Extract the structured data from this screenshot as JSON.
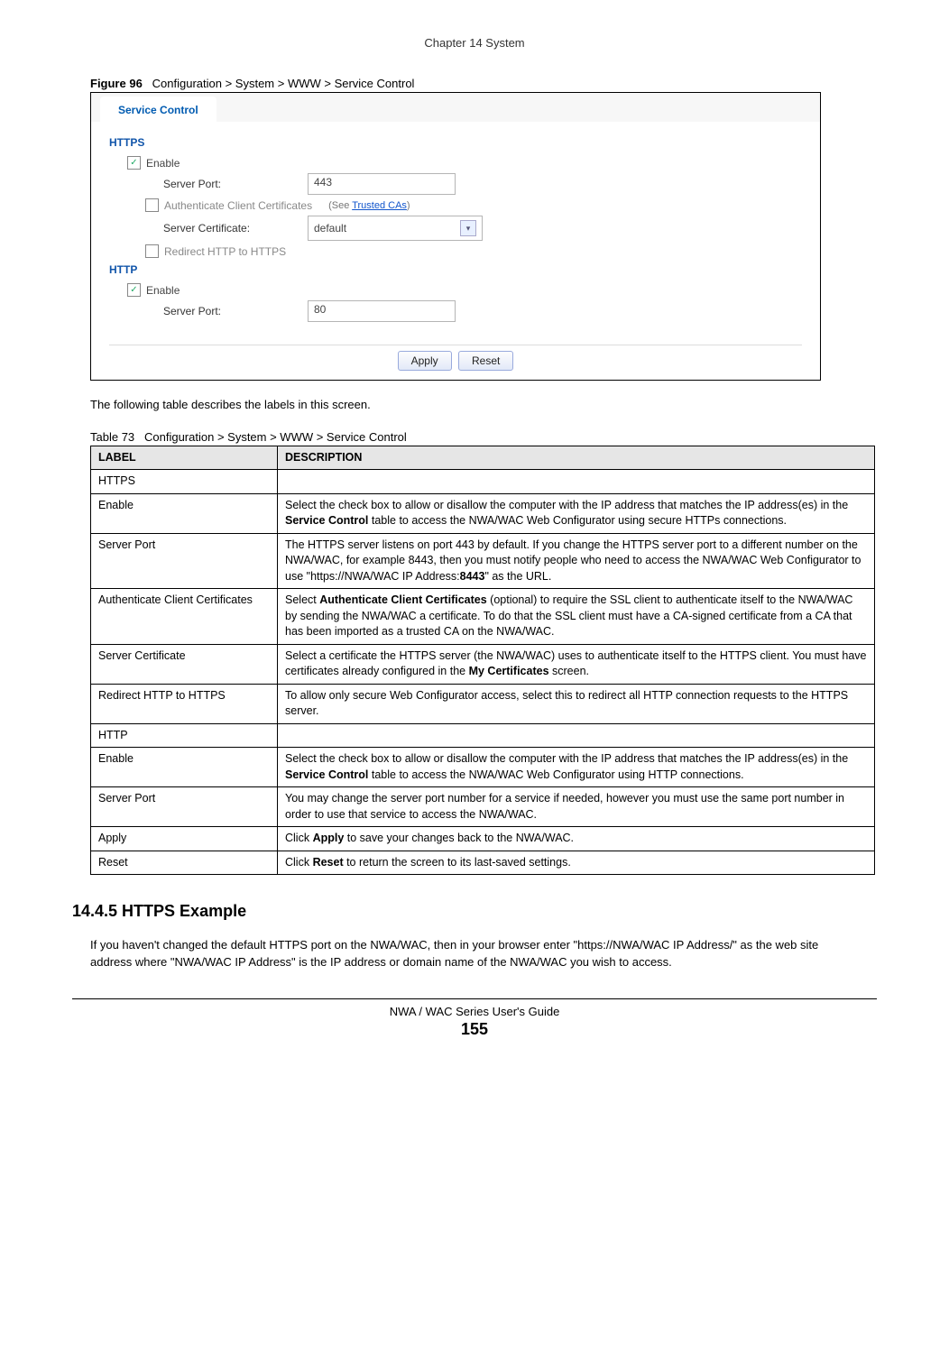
{
  "chapter_header": "Chapter 14 System",
  "figure": {
    "label": "Figure 96",
    "caption": "Configuration > System > WWW > Service Control"
  },
  "screenshot": {
    "tab": "Service Control",
    "https": {
      "title": "HTTPS",
      "enable_label": "Enable",
      "enable_checked": "✓",
      "server_port_label": "Server Port:",
      "server_port_value": "443",
      "auth_cert_label": "Authenticate Client Certificates",
      "see_prefix": "(See ",
      "see_link": "Trusted CAs",
      "see_suffix": ")",
      "server_cert_label": "Server Certificate:",
      "server_cert_value": "default",
      "redirect_label": "Redirect HTTP to HTTPS"
    },
    "http": {
      "title": "HTTP",
      "enable_label": "Enable",
      "enable_checked": "✓",
      "server_port_label": "Server Port:",
      "server_port_value": "80"
    },
    "buttons": {
      "apply": "Apply",
      "reset": "Reset"
    }
  },
  "intro_para": "The following table describes the labels in this screen.",
  "table": {
    "label": "Table 73",
    "caption": "Configuration > System > WWW > Service Control",
    "header_label": "LABEL",
    "header_desc": "DESCRIPTION",
    "rows": {
      "r0_label": "HTTPS",
      "r0_desc": "",
      "r1_label": "Enable",
      "r1_desc_a": "Select the check box to allow or disallow the computer with the IP address that matches the IP address(es) in the ",
      "r1_desc_bold": "Service Control",
      "r1_desc_b": " table to access the NWA/WAC Web Configurator using secure HTTPs connections.",
      "r2_label": "Server Port",
      "r2_desc_a": "The HTTPS server listens on port 443 by default. If you change the HTTPS server port to a different number on the NWA/WAC, for example 8443, then you must notify people who need to access the NWA/WAC Web Configurator to use \"https://NWA/WAC IP Address:",
      "r2_desc_bold": "8443",
      "r2_desc_b": "\" as the URL.",
      "r3_label": "Authenticate Client Certificates",
      "r3_desc_a": "Select ",
      "r3_desc_bold": "Authenticate Client Certificates",
      "r3_desc_b": " (optional) to require the SSL client to authenticate itself to the NWA/WAC by sending the NWA/WAC a certificate. To do that the SSL client must have a CA-signed certificate from a CA that has been imported as a trusted CA on the NWA/WAC.",
      "r4_label": "Server Certificate",
      "r4_desc_a": "Select a certificate the HTTPS server (the NWA/WAC) uses to authenticate itself to the HTTPS client. You must have certificates already configured in the ",
      "r4_desc_bold": "My Certificates",
      "r4_desc_b": " screen.",
      "r5_label": "Redirect HTTP to HTTPS",
      "r5_desc": "To allow only secure Web Configurator access, select this to redirect all HTTP connection requests to the HTTPS server.",
      "r6_label": "HTTP",
      "r6_desc": "",
      "r7_label": "Enable",
      "r7_desc_a": "Select the check box to allow or disallow the computer with the IP address that matches the IP address(es) in the ",
      "r7_desc_bold": "Service Control",
      "r7_desc_b": " table to access the NWA/WAC Web Configurator using HTTP connections.",
      "r8_label": "Server Port",
      "r8_desc": "You may change the server port number for a service if needed, however you must use the same port number in order to use that service to access the NWA/WAC.",
      "r9_label": "Apply",
      "r9_desc_a": "Click ",
      "r9_desc_bold": "Apply",
      "r9_desc_b": " to save your changes back to the NWA/WAC.",
      "r10_label": "Reset",
      "r10_desc_a": "Click ",
      "r10_desc_bold": "Reset",
      "r10_desc_b": " to return the screen to its last-saved settings."
    }
  },
  "example": {
    "heading": "14.4.5  HTTPS Example",
    "para": "If you haven't changed the default HTTPS port on the NWA/WAC, then in your browser enter \"https://NWA/WAC IP Address/\" as the web site address where \"NWA/WAC IP Address\" is the IP address or domain name of the NWA/WAC you wish to access."
  },
  "footer": {
    "guide": "NWA / WAC Series User's Guide",
    "page": "155"
  }
}
